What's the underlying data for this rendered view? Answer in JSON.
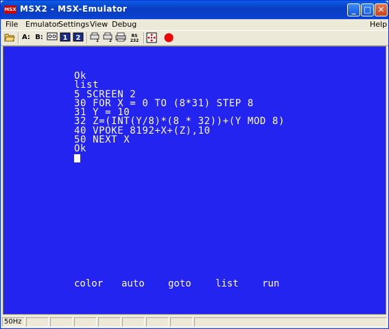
{
  "window": {
    "title": "MSX2 - MSX-Emulator",
    "icon_text": "MSX",
    "controls": [
      "_",
      "□",
      "✕"
    ]
  },
  "menubar": {
    "items": [
      {
        "label": "File"
      },
      {
        "label": "Emulator"
      },
      {
        "label": "Settings"
      },
      {
        "label": "View"
      },
      {
        "label": "Debug"
      }
    ],
    "help": "Help"
  },
  "toolbar": {
    "drive_a": "A:",
    "drive_b": "B:",
    "icons": [
      "open-folder-icon",
      "cassette-icon",
      "cartridge-1-icon",
      "cartridge-2-icon",
      "printer-1-icon",
      "printer-2-icon",
      "printer-icon",
      "rs232-icon",
      "joystick-icon",
      "record-icon"
    ],
    "cart1_label": "1",
    "cart2_label": "2",
    "rs232_label": "RS 232"
  },
  "screen": {
    "background": "#2424f0",
    "lines": [
      "Ok",
      "list",
      "5 SCREEN 2",
      "30 FOR X = 0 TO (8*31) STEP 8",
      "31 Y = 10",
      "32 Z=(INT(Y/8)*(8 * 32))+(Y MOD 8)",
      "40 VPOKE 8192+X+(Z),10",
      "50 NEXT X",
      "Ok"
    ],
    "function_keys": [
      "color",
      "auto",
      "goto",
      "list",
      "run"
    ]
  },
  "statusbar": {
    "fps": "50Hz"
  }
}
